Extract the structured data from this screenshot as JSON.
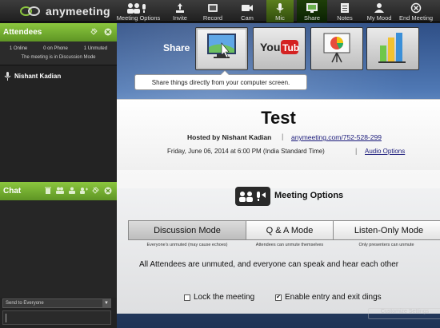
{
  "app": {
    "logo_text": "anymeeting"
  },
  "toolbar": {
    "items": [
      {
        "label": "Meeting Options",
        "icon": "meeting-options-icon"
      },
      {
        "label": "Invite",
        "icon": "invite-icon"
      },
      {
        "label": "Record",
        "icon": "record-icon"
      },
      {
        "label": "Cam",
        "icon": "cam-icon"
      },
      {
        "label": "Mic",
        "icon": "mic-icon"
      },
      {
        "label": "Share",
        "icon": "share-icon"
      },
      {
        "label": "Notes",
        "icon": "notes-icon"
      },
      {
        "label": "My Mood",
        "icon": "my-mood-icon"
      },
      {
        "label": "End Meeting",
        "icon": "end-meeting-icon"
      }
    ]
  },
  "attendees": {
    "title": "Attendees",
    "online": "1 Online",
    "on_phone": "0 on Phone",
    "unmuted": "1 Unmuted",
    "mode_note": "The meeting is in Discussion Mode",
    "list": [
      "Nishant Kadian"
    ]
  },
  "chat": {
    "title": "Chat",
    "send_to": "Send to Everyone"
  },
  "share": {
    "label": "Share",
    "tooltip": "Share things directly from your computer screen.",
    "tiles": [
      {
        "icon": "screen-share-icon"
      },
      {
        "icon": "youtube-icon"
      },
      {
        "icon": "presentation-icon"
      },
      {
        "icon": "chart-document-icon"
      }
    ]
  },
  "meeting": {
    "title": "Test",
    "hosted_by": "Hosted by Nishant Kadian",
    "separator": "|",
    "link": "anymeeting.com/752-528-299",
    "datetime": "Friday, June 06, 2014 at 6:00 PM (India Standard Time)",
    "audio_options": "Audio Options"
  },
  "options": {
    "title": "Meeting Options",
    "modes": [
      {
        "label": "Discussion Mode",
        "note": "Everyone's unmuted (may cause echoes)"
      },
      {
        "label": "Q & A Mode",
        "note": "Attendees can unmute themselves"
      },
      {
        "label": "Listen-Only Mode",
        "note": "Only presenters can unmute"
      }
    ],
    "description": "All Attendees are unmuted, and everyone can speak and hear each other",
    "lock_label": "Lock the meeting",
    "dings_label": "Enable entry and exit dings",
    "lock_checked": false,
    "dings_checked": true,
    "faded_button": "Customize Settings"
  },
  "colors": {
    "accent_green": "#8bc63e",
    "dark_bg": "#232323"
  }
}
